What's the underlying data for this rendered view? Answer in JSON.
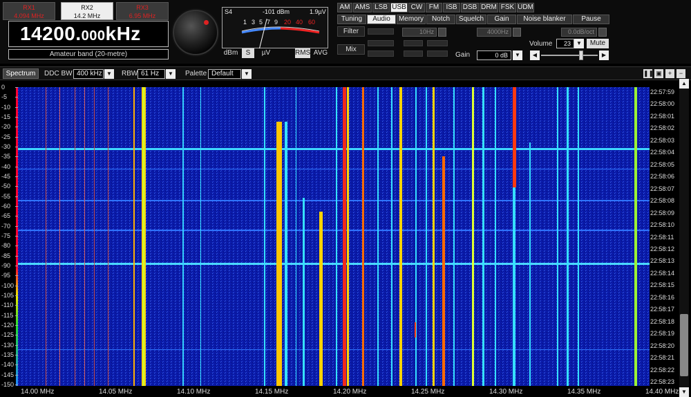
{
  "receivers": [
    {
      "name": "RX1",
      "freq": "4.094 MHz",
      "active": false
    },
    {
      "name": "RX2",
      "freq": "14.2 MHz",
      "active": true
    },
    {
      "name": "RX3",
      "freq": "6.95 MHz",
      "active": false
    }
  ],
  "frequency": {
    "main": "14200.",
    "decimals": "000",
    "unit": "kHz"
  },
  "band": "Amateur band (20-metre)",
  "smeter": {
    "label": "S4",
    "dbm": "-101 dBm",
    "uv": "1.9µV",
    "scale_white": [
      "1",
      "3",
      "5",
      "7",
      "9"
    ],
    "scale_red": [
      "20",
      "40",
      "60"
    ],
    "buttons": [
      "dBm",
      "S",
      "µV",
      "RMS",
      "AVG"
    ],
    "selected": [
      "S",
      "RMS"
    ]
  },
  "modes": [
    "AM",
    "AMS",
    "LSB",
    "USB",
    "CW",
    "FM",
    "ISB",
    "DSB",
    "DRM",
    "FSK",
    "UDM"
  ],
  "mode_selected": "USB",
  "tabs": [
    "Tuning",
    "Audio",
    "Memory",
    "Notch",
    "Squelch",
    "Gain",
    "Noise blanker",
    "Pause"
  ],
  "tab_selected": "Audio",
  "audio": {
    "filter_label": "Filter",
    "mix_label": "Mix",
    "filter_low": "10Hz",
    "filter_high": "4000Hz",
    "filter_slope": "0.0dB/oct",
    "gain_label": "Gain",
    "gain_value": "0 dB",
    "volume_label": "Volume",
    "volume_value": "23",
    "mute_label": "Mute"
  },
  "spectrum_bar": {
    "spectrum_label": "Spectrum",
    "ddc_bw_label": "DDC BW",
    "ddc_bw_value": "400 kHz",
    "rbw_label": "RBW",
    "rbw_value": "61 Hz",
    "palette_label": "Palette",
    "palette_value": "Default"
  },
  "y_axis": [
    "0",
    "-5",
    "-10",
    "-15",
    "-20",
    "-25",
    "-30",
    "-35",
    "-40",
    "-45",
    "-50",
    "-55",
    "-60",
    "-65",
    "-70",
    "-75",
    "-80",
    "-85",
    "-90",
    "-95",
    "-100",
    "-105",
    "-110",
    "-115",
    "-120",
    "-125",
    "-130",
    "-135",
    "-140",
    "-145",
    "-150"
  ],
  "times": [
    "22:57:59",
    "22:58:00",
    "22:58:01",
    "22:58:02",
    "22:58:03",
    "22:58:04",
    "22:58:05",
    "22:58:06",
    "22:58:07",
    "22:58:08",
    "22:58:09",
    "22:58:10",
    "22:58:11",
    "22:58:12",
    "22:58:13",
    "22:58:14",
    "22:58:15",
    "22:58:16",
    "22:58:17",
    "22:58:18",
    "22:58:19",
    "22:58:20",
    "22:58:21",
    "22:58:22",
    "22:58:23"
  ],
  "x_axis": [
    "14.00 MHz",
    "14.05 MHz",
    "14.10 MHz",
    "14.15 MHz",
    "14.20 MHz",
    "14.25 MHz",
    "14.30 MHz",
    "14.35 MHz",
    "14.40 MHz"
  ],
  "colors": {
    "background": "#0a1aa8",
    "accent": "#d22"
  }
}
